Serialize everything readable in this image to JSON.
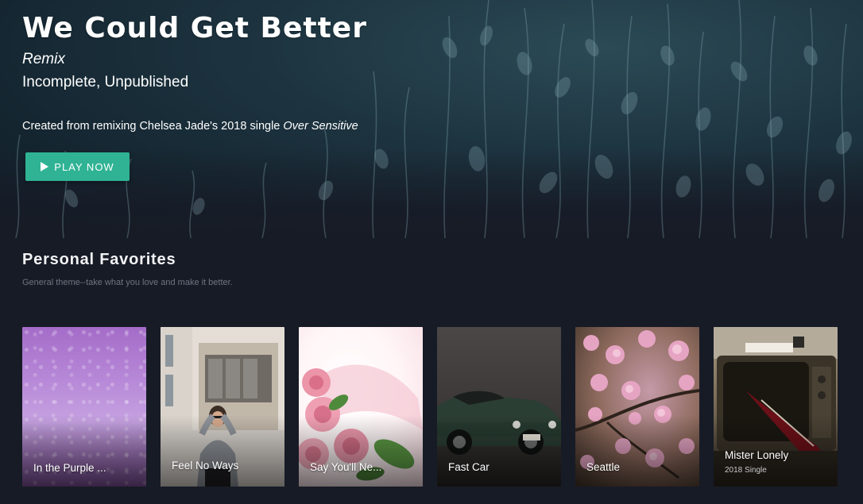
{
  "hero": {
    "title": "We Could Get Better",
    "type": "Remix",
    "status": "Incomplete, Unpublished",
    "description_prefix": "Created from remixing Chelsea Jade's 2018 single ",
    "description_emphasis": "Over Sensitive",
    "play_button": {
      "label": "PLAY NOW",
      "icon": "play-icon",
      "color": "#2fb394"
    },
    "background": "dark-teal-foliage-photo"
  },
  "section": {
    "title": "Personal Favorites",
    "subtitle": "General theme--take what you love and make it better."
  },
  "cards": [
    {
      "title": "In the Purple ...",
      "meta": "",
      "art": "purple-rain-window"
    },
    {
      "title": "Feel No Ways",
      "meta": "",
      "art": "woman-in-sweater-by-building"
    },
    {
      "title": "Say You'll Ne...",
      "meta": "",
      "art": "pink-roses"
    },
    {
      "title": "Fast Car",
      "meta": "",
      "art": "green-classic-car"
    },
    {
      "title": "Seattle",
      "meta": "",
      "art": "cherry-blossoms"
    },
    {
      "title": "Mister Lonely",
      "meta": "2018 Single",
      "art": "guitar-in-old-tv"
    }
  ],
  "colors": {
    "background": "#171b26",
    "accent": "#2fb394",
    "subtitle": "#6f7480"
  }
}
